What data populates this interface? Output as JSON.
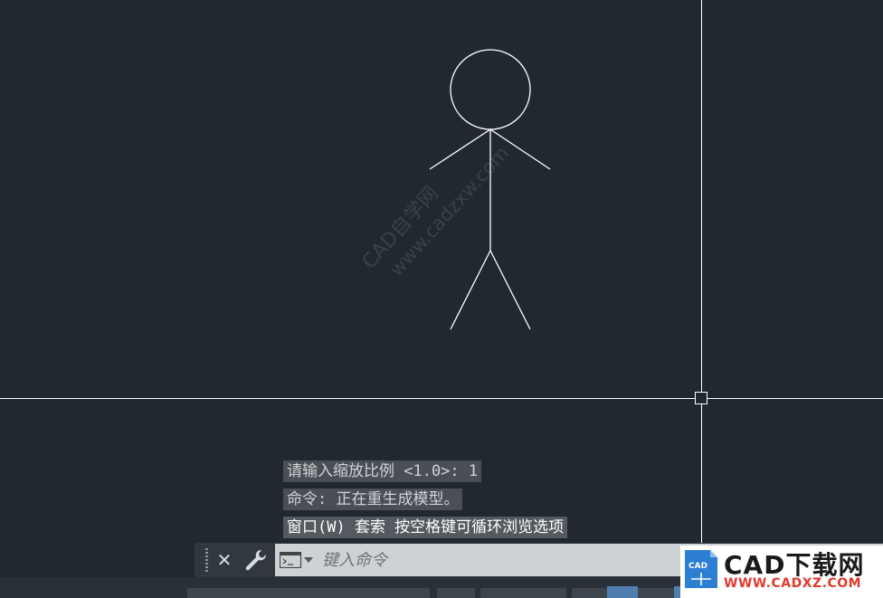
{
  "watermark": {
    "line1": "CAD自学网",
    "line2": "www.cadzxw.com"
  },
  "command_history": [
    "请输入缩放比例 <1.0>: 1",
    "命令: 正在重生成模型。",
    "窗口(W) 套索  按空格键可循环浏览选项"
  ],
  "command_line": {
    "placeholder": "键入命令"
  },
  "logo": {
    "main": "CAD下载网",
    "sub": "WWW.CADXZ.COM",
    "icon_text": "CAD"
  },
  "icons": {
    "close": "close-icon",
    "customize": "wrench-icon",
    "prompt": "command-prompt-icon",
    "crosshair": "crosshair-cursor-icon"
  },
  "colors": {
    "canvas_bg": "#212830",
    "drawing_lines": "#ffffff",
    "status_active": "#4e7fae",
    "logo_accent": "#e23a2e"
  }
}
